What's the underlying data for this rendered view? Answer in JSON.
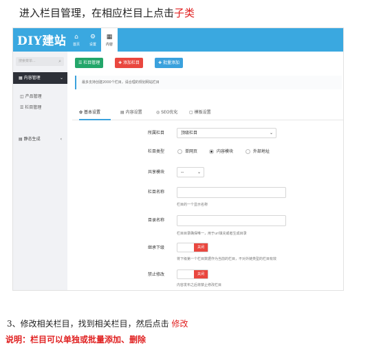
{
  "doc": {
    "step_intro": "进入栏目管理，在相应栏目上点击",
    "step_intro_highlight": "子类",
    "step3_text": "3、修改相关栏目，找到相关栏目，然后点击",
    "step3_highlight": "修改",
    "note": "说明：栏目可以单独或批量添加、删除"
  },
  "app": {
    "brand": "DIY建站",
    "topnav": [
      {
        "label": "首页",
        "icon": "home-icon",
        "glyph": "⌂"
      },
      {
        "label": "设置",
        "icon": "gear-icon",
        "glyph": "⚙"
      },
      {
        "label": "内容",
        "icon": "grid-icon",
        "glyph": "▦"
      }
    ],
    "sidebar": {
      "search_placeholder": "搜索菜单...",
      "menu_label": "内容管理",
      "sub_items": [
        "产品管理",
        "栏目管理"
      ],
      "item2_label": "静态生成"
    },
    "toolbar": {
      "btn_manage": "栏目管理",
      "btn_add": "添加栏目",
      "btn_batch": "批量添加"
    },
    "notice": "最多支持创建2000个栏目，请合理的规划网站栏目",
    "tabs": [
      "基本设置",
      "内容设置",
      "SEO优化",
      "模板设置"
    ],
    "form": {
      "parent_label": "所属栏目",
      "parent_value": "顶级栏目",
      "type_label": "栏目类型",
      "type_options": [
        "单网页",
        "内容模块",
        "外部地址"
      ],
      "type_selected_index": 1,
      "module_label": "共享模块",
      "module_value": "--",
      "name_label": "栏目名称",
      "name_help": "栏目的一个显示名称",
      "dir_label": "目录名称",
      "dir_help": "栏目目录确保唯一，用于url填充或者生成目录",
      "inherit_label": "继承下级",
      "inherit_toggle": "关闭",
      "inherit_help": "将下级第一个栏目数据作为当前的栏目，不对外链类型的栏目有效",
      "disable_label": "禁止修改",
      "disable_toggle": "关闭",
      "disable_help": "内容发布之后将禁止修改栏目"
    }
  }
}
